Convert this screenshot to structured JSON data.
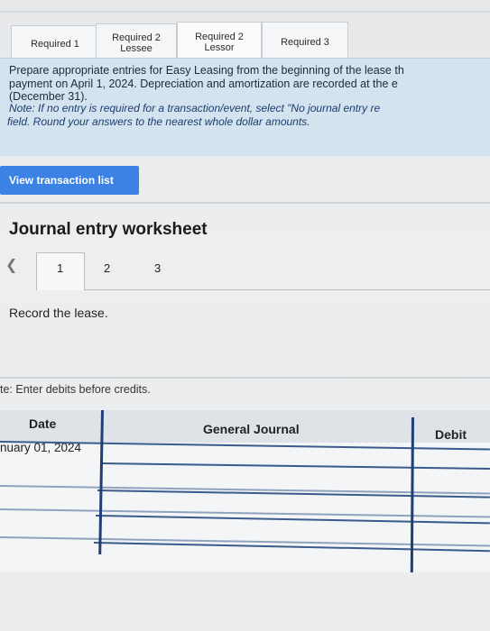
{
  "tabs": [
    {
      "label": "Required 1"
    },
    {
      "label": "Required 2 Lessee"
    },
    {
      "label": "Required 2 Lessor"
    },
    {
      "label": "Required 3"
    }
  ],
  "instructions": {
    "line1": "Prepare appropriate entries for Easy Leasing from the beginning of the lease th",
    "line2": "payment on April 1, 2024. Depreciation and amortization are recorded at the e",
    "line3": "(December 31).",
    "note1": "Note: If no entry is required for a transaction/event, select \"No journal entry re",
    "note2": "field. Round your answers to the nearest whole dollar amounts."
  },
  "view_button": "View transaction list",
  "worksheet": {
    "title": "Journal entry worksheet",
    "pages": [
      "1",
      "2",
      "3"
    ],
    "prev_icon": "chevron-left-icon",
    "instruction": "Record the lease.",
    "note": "te: Enter debits before credits."
  },
  "table": {
    "headers": {
      "date": "Date",
      "journal": "General Journal",
      "debit": "Debit"
    },
    "rows": [
      {
        "date": "nuary 01, 2024"
      }
    ]
  }
}
